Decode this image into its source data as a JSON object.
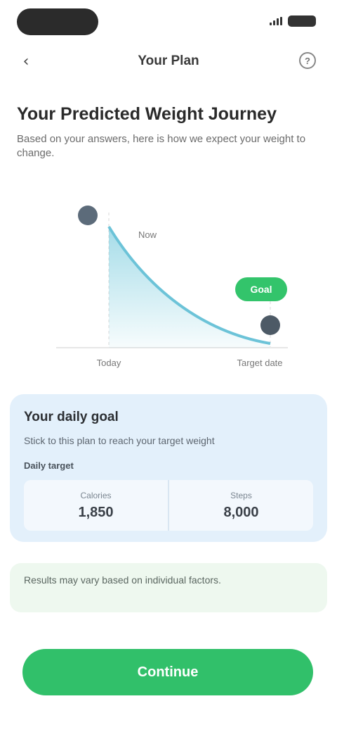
{
  "nav": {
    "back_glyph": "‹",
    "title": "Your Plan",
    "help_glyph": "?"
  },
  "content": {
    "headline": "Your Predicted Weight Journey",
    "subtext": "Based on your answers, here is how we expect your weight to change."
  },
  "chart_data": {
    "type": "area",
    "x_labels": [
      "Today",
      "Target date"
    ],
    "start_marker": "Now",
    "goal_badge": "Goal",
    "series_color": "#5bc0d6",
    "goal_color": "#33c46b"
  },
  "info_card": {
    "title": "Your daily goal",
    "subtitle": "Stick to this plan to reach your target weight",
    "label": "Daily target",
    "columns": [
      {
        "label": "Calories",
        "value": "1,850"
      },
      {
        "label": "Steps",
        "value": "8,000"
      }
    ]
  },
  "note": {
    "text": "Results may vary based on individual factors."
  },
  "cta": {
    "label": "Continue"
  },
  "colors": {
    "accent": "#31c06a",
    "card_blue": "#e3f0fb",
    "card_green": "#eef8ef"
  }
}
